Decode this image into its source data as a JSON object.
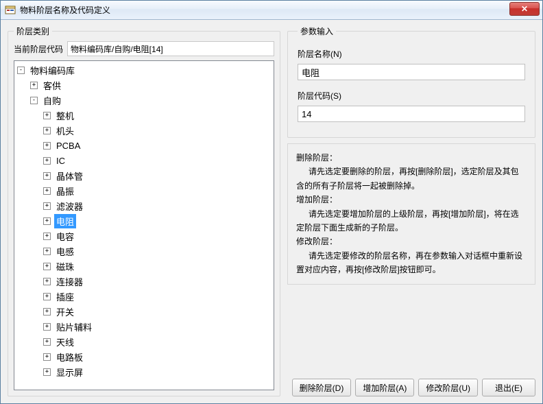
{
  "window": {
    "title": "物料阶层名称及代码定义"
  },
  "left": {
    "group_legend": "阶层类别",
    "path_label": "当前阶层代码",
    "path_value": "物料编码库/自购/电阻[14]"
  },
  "tree": {
    "root": {
      "label": "物料编码库",
      "expanded": true
    },
    "children": [
      {
        "label": "客供",
        "expanded": false,
        "children": []
      },
      {
        "label": "自购",
        "expanded": true,
        "children": [
          {
            "label": "整机"
          },
          {
            "label": "机头"
          },
          {
            "label": "PCBA"
          },
          {
            "label": "IC"
          },
          {
            "label": "晶体管"
          },
          {
            "label": "晶振"
          },
          {
            "label": "滤波器"
          },
          {
            "label": "电阻",
            "selected": true
          },
          {
            "label": "电容"
          },
          {
            "label": "电感"
          },
          {
            "label": "磁珠"
          },
          {
            "label": "连接器"
          },
          {
            "label": "插座"
          },
          {
            "label": "开关"
          },
          {
            "label": "贴片辅料"
          },
          {
            "label": "天线"
          },
          {
            "label": "电路板"
          },
          {
            "label": "显示屏"
          }
        ]
      }
    ]
  },
  "params": {
    "group_legend": "参数输入",
    "name_label": "阶层名称(N)",
    "name_value": "电阻",
    "code_label": "阶层代码(S)",
    "code_value": "14"
  },
  "help": {
    "delete_h": "删除阶层：",
    "delete_p": "请先选定要删除的阶层，再按[删除阶层]，选定阶层及其包含的所有子阶层将一起被删除掉。",
    "add_h": "增加阶层：",
    "add_p": "请先选定要增加阶层的上级阶层，再按[增加阶层]，将在选定阶层下面生成新的子阶层。",
    "modify_h": "修改阶层：",
    "modify_p": "请先选定要修改的阶层名称，再在参数输入对话框中重新设置对应内容，再按[修改阶层]按钮即可。"
  },
  "buttons": {
    "delete": "删除阶层(D)",
    "add": "增加阶层(A)",
    "modify": "修改阶层(U)",
    "exit": "退出(E)"
  }
}
